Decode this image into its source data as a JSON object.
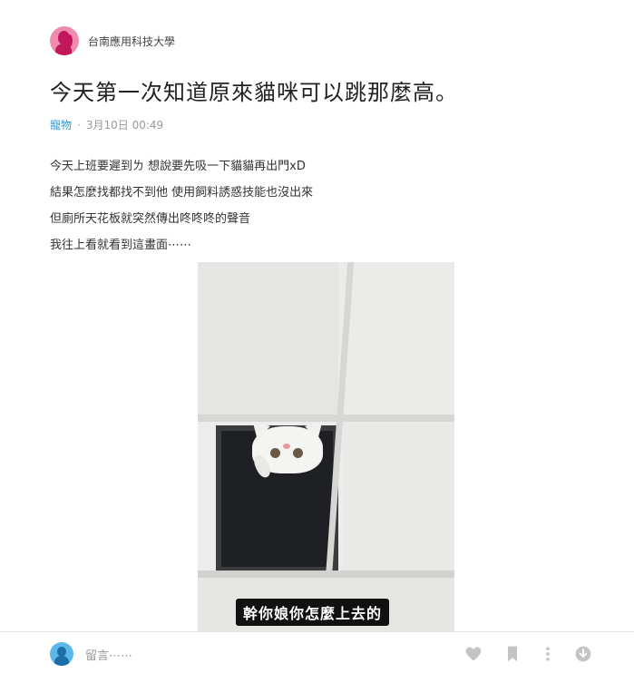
{
  "post": {
    "forum": "台南應用科技大學",
    "title": "今天第一次知道原來貓咪可以跳那麼高。",
    "category": "寵物",
    "separator": "·",
    "date": "3月10日 00:49",
    "body_lines": [
      "今天上班要遲到ㄌ 想說要先吸一下貓貓再出門xD",
      "結果怎麼找都找不到他 使用飼料誘惑技能也沒出來",
      "但廁所天花板就突然傳出咚咚咚的聲音",
      "我往上看就看到這畫面⋯⋯"
    ],
    "image_caption": "幹你娘你怎麼上去的"
  },
  "footer": {
    "comment_placeholder": "留言⋯⋯",
    "icons": [
      "heart-icon",
      "bookmark-icon",
      "more-icon",
      "download-icon"
    ]
  },
  "colors": {
    "forum_avatar": "#f08bb0",
    "category": "#3397cf",
    "user_avatar": "#5cb8e8",
    "icon_gray": "#c4c4c4"
  }
}
